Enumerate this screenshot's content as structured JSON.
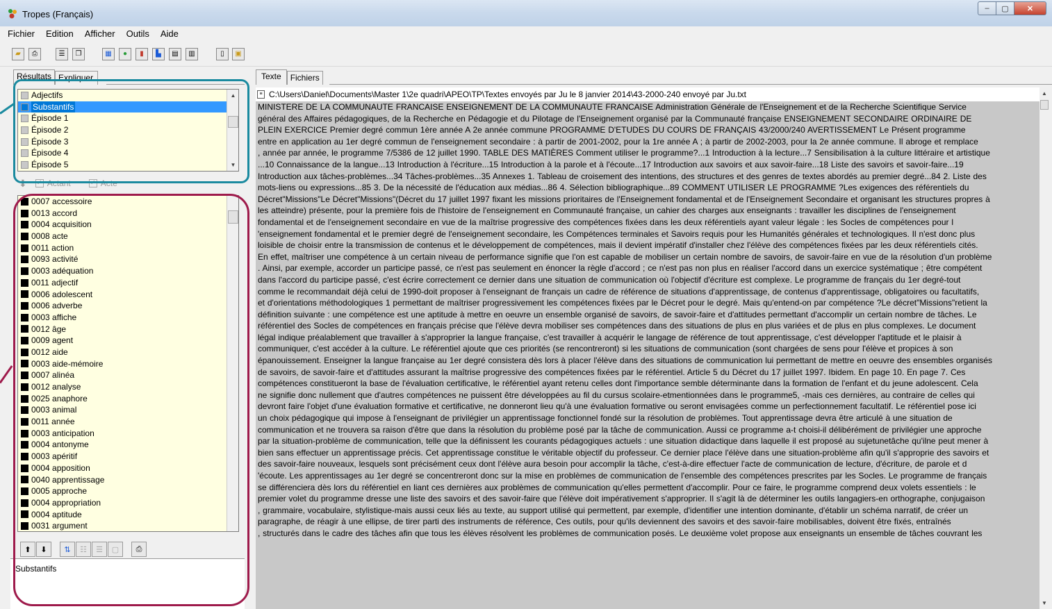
{
  "window": {
    "title": "Tropes (Français)",
    "controls": {
      "minimize": "–",
      "maximize": "▢",
      "close": "✕"
    }
  },
  "menu": [
    "Fichier",
    "Edition",
    "Afficher",
    "Outils",
    "Aide"
  ],
  "toolbar": {
    "icons": [
      "open-folder-icon",
      "print-icon",
      "properties-icon",
      "copy-icon",
      "grid-view-icon",
      "tropes-logo-icon",
      "bar-chart-color-icon",
      "bar-chart-icon",
      "stacked-chart-icon",
      "table-icon",
      "notes-icon",
      "export-icon"
    ]
  },
  "left_panel": {
    "tabs": [
      "Résultats",
      "Expliquer"
    ],
    "categories": {
      "items": [
        {
          "label": "Adjectifs",
          "selected": false
        },
        {
          "label": "Substantifs",
          "selected": true
        },
        {
          "label": "Épisode 1",
          "selected": false
        },
        {
          "label": "Épisode 2",
          "selected": false
        },
        {
          "label": "Épisode 3",
          "selected": false
        },
        {
          "label": "Épisode 4",
          "selected": false
        },
        {
          "label": "Épisode 5",
          "selected": false
        }
      ]
    },
    "filters": {
      "actant": "Actant",
      "acte": "Acte"
    },
    "words": [
      "0007 accessoire",
      "0013 accord",
      "0004 acquisition",
      "0008 acte",
      "0011 action",
      "0093 activité",
      "0003 adéquation",
      "0011 adjectif",
      "0006 adolescent",
      "0006 adverbe",
      "0003 affiche",
      "0012 âge",
      "0009 agent",
      "0012 aide",
      "0003 aide-mémoire",
      "0007 alinéa",
      "0012 analyse",
      "0025 anaphore",
      "0003 animal",
      "0011 année",
      "0003 anticipation",
      "0004 antonyme",
      "0003 apéritif",
      "0004 apposition",
      "0040 apprentissage",
      "0005 approche",
      "0004 appropriation",
      "0004 aptitude",
      "0031 argument"
    ],
    "status": "Substantifs"
  },
  "right_panel": {
    "tabs": [
      "Texte",
      "Fichiers"
    ],
    "file_path": "C:\\Users\\Daniel\\Documents\\Master 1\\2e quadri\\APEO\\TP\\Textes envoyés par Ju le 8 janvier 2014\\43-2000-240 envoyé par Ju.txt",
    "lines": [
      "MINISTERE DE LA COMMUNAUTE FRANCAISE ENSEIGNEMENT DE LA COMMUNAUTE FRANCAISE Administration Générale de l'Enseignement et de la Recherche Scientifique Service",
      "général des Affaires pédagogiques, de la Recherche en Pédagogie et du Pilotage de l'Enseignement organisé par la Communauté  française ENSEIGNEMENT SECONDAIRE ORDINAIRE DE",
      "PLEIN EXERCICE Premier degré commun 1ère année A 2e année commune PROGRAMME D'ETUDES DU COURS DE FRANÇAIS 43/2000/240 AVERTISSEMENT  Le Présent programme",
      "entre en application au 1er degré commun de l'enseignement secondaire : à partir de 2001-2002, pour la 1re année A ; à partir de 2002-2003, pour la 2e année commune. Il abroge et remplace",
      ", année par année, le programme 7/5386 de 12 juillet 1990. TABLE DES MATIÈRES Comment utiliser le programme?...1 Introduction à la lecture...7 Sensibilisation à la culture littéraire et artistique",
      "...10 Connaissance de la langue...13 Introduction à l'écriture...15 Introduction à la parole et à l'écoute...17 Introduction aux savoirs et aux savoir-faire...18 Liste des savoirs et savoir-faire...19",
      "Introduction aux tâches-problèmes...34 Tâches-problèmes...35 Annexes 1. Tableau de croisement des intentions, des structures et des genres de textes abordés au premier degré...84 2. Liste des",
      "mots-liens ou expressions...85 3. De la nécessité de l'éducation aux médias...86 4. Sélection bibliographique...89 COMMENT UTILISER LE PROGRAMME ?Les exigences des référentiels du",
      "Décret\"Missions\"Le Décret\"Missions\"(Décret du 17 juillet 1997 fixant les missions prioritaires de l'Enseignement fondamental  et de l'Enseignement Secondaire et organisant les structures propres à",
      "les atteindre) présente, pour la première fois de l'histoire de l'enseignement en Communauté française, un cahier des charges aux enseignants : travailler les disciplines de l'enseignement",
      "fondamental  et de l'enseignement secondaire en vue de la maîtrise progressive des compétences fixées dans les deux référentiels ayant valeur légale : les Socles de compétences pour l",
      "'enseignement fondamental et le premier degré de l'enseignement secondaire, les Compétences terminales et Savoirs requis pour les Humanités générales et technologiques. Il n'est  donc plus",
      "loisible de choisir entre la transmission de contenus et le développement de compétences,  mais il devient impératif d'installer chez l'élève des compétences fixées par les deux référentiels cités.",
      "En effet, maîtriser une compétence à un certain niveau de performance signifie que l'on est capable de mobiliser un certain nombre de savoirs, de savoir-faire en vue de la résolution d'un problème",
      ". Ainsi, par exemple, accorder un participe passé,  ce n'est pas seulement en énoncer la règle d'accord ; ce n'est pas non plus en réaliser l'accord dans un exercice systématique ; être compétent",
      "dans l'accord du participe passé,  c'est écrire correctement ce dernier dans une situation de communication où l'objectif d'écriture est complexe. Le programme de français du 1er degré-tout",
      "comme le recommandait déjà celui de 1990-doit proposer à l'enseignant de français un cadre de référence de situations d'apprentissage, de contenus d'apprentissage, obligatoires ou facultatifs,",
      "et d'orientations méthodologiques 1 permettant de maîtriser progressivement les compétences fixées par le Décret pour le degré. Mais qu'entend-on par compétence ?Le décret\"Missions\"retient la",
      "définition suivante : une compétence est une aptitude à mettre en oeuvre un ensemble organisé de savoirs,  de savoir-faire et d'attitudes permettant d'accomplir un certain nombre de tâches. Le",
      "référentiel des Socles de compétences en français précise que l'élève devra mobiliser ses compétences dans des situations de plus en plus variées et de plus en plus complexes. Le document",
      "légal indique préalablement  que travailler à s'approprier la langue française,  c'est travailler à acquérir le langage de référence de tout apprentissage,  c'est développer l'aptitude  et le plaisir à",
      "communiquer,  c'est accéder à la culture. Le référentiel ajoute  que ces priorités (se rencontreront)  si les situations de communication (sont chargées de sens pour l'élève et propices à son",
      "épanouissement. Enseigner la langue française au 1er degré consistera dès lors à placer l'élève dans des situations de communication lui permettant de mettre en oeuvre des ensembles organisés",
      "de savoirs,  de savoir-faire et d'attitudes assurant la maîtrise progressive des compétences fixées par le référentiel. Article 5 du Décret du 17 juillet 1997.  Ibidem. En page 10. En page 7. Ces",
      "compétences constitueront la base de l'évaluation certificative,  le référentiel ayant retenu celles  dont l'importance semble déterminante dans la formation de l'enfant et du jeune adolescent. Cela",
      "ne signifie  donc nullement que d'autres compétences ne puissent être développées au fil du cursus scolaire-etmentionnées dans le programme5, -mais ces dernières,  au contraire de celles qui",
      "devront faire l'objet d'une évaluation formative et certificative,  ne donneront lieu  qu'à une évaluation formative ou seront envisagées comme un perfectionnement facultatif. Le référentiel pose ici",
      "un choix pédagogique  qui impose à l'enseignant de privilégier un apprentissage fonctionnel fondé sur la résolution de problèmes. Tout apprentissage devra être articulé à une situation de",
      "communication  et ne trouvera sa raison d'être que dans la résolution du problème posé par la tâche de communication. Aussi ce programme a-t choisi-il délibérément de privilégier une approche",
      "par la situation-problème de communication, telle  que la définissent les courants pédagogiques actuels : une situation didactique dans laquelle il est proposé au sujetunetâche qu'ilne peut mener à",
      "bien sans effectuer un apprentissage précis. Cet apprentissage constitue le véritable objectif du professeur. Ce dernier place l'élève dans une situation-problème afin qu'il s'approprie des savoirs et",
      "des savoir-faire nouveaux,  lesquels sont précisément ceux dont l'élève aura besoin pour accomplir la tâche,  c'est-à-dire effectuer l'acte de communication de lecture, d'écriture, de parole et d",
      "'écoute. Les apprentissages au 1er degré se concentreront donc sur la mise en problèmes de communication de l'ensemble des compétences prescrites par les Socles. Le programme de français",
      " se différenciera dès lors du référentiel  en liant ces dernières aux problèmes de communication  qu'elles permettent d'accomplir. Pour ce faire, le programme comprend deux volets essentiels : le",
      "premier volet du programme dresse une liste des savoirs et des savoir-faire  que l'élève doit impérativement s'approprier. Il s'agit là de déterminer les outils langagiers-en orthographe, conjugaison",
      ", grammaire, vocabulaire, stylistique-mais aussi ceux liés au texte,  au support utilisé  qui permettent, par exemple, d'identifier une intention dominante,  d'établir un schéma narratif,  de créer un",
      "paragraphe,  de réagir à une ellipse,  de tirer parti des instruments de référence, Ces outils,  pour qu'ils deviennent des savoirs  et des savoir-faire mobilisables, doivent être fixés,  entraînés",
      ", structurés dans le cadre des tâches  afin que tous les élèves résolvent les problèmes de communication posés. Le deuxième volet propose aux enseignants un ensemble de tâches couvrant les"
    ]
  }
}
